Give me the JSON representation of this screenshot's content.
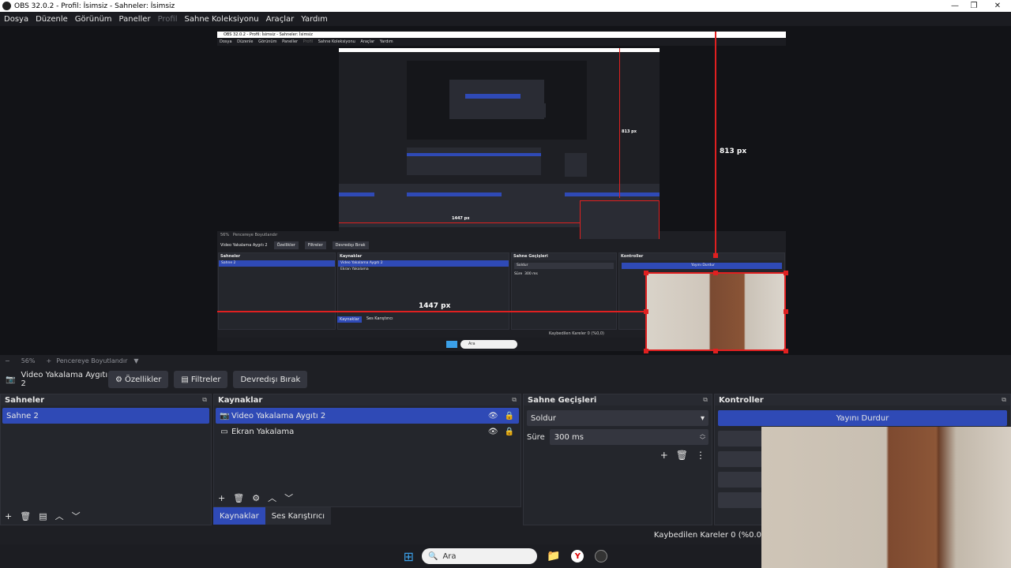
{
  "window": {
    "title": "OBS 32.0.2 - Profil: İsimsiz - Sahneler: İsimsiz",
    "minimize": "—",
    "maximize": "❐",
    "close": "✕"
  },
  "menu": [
    {
      "label": "Dosya",
      "enabled": true
    },
    {
      "label": "Düzenle",
      "enabled": true
    },
    {
      "label": "Görünüm",
      "enabled": true
    },
    {
      "label": "Paneller",
      "enabled": true
    },
    {
      "label": "Profil",
      "enabled": false
    },
    {
      "label": "Sahne Koleksiyonu",
      "enabled": true
    },
    {
      "label": "Araçlar",
      "enabled": true
    },
    {
      "label": "Yardım",
      "enabled": true
    }
  ],
  "preview": {
    "measure_horizontal": "1447 px",
    "measure_vertical": "813 px",
    "nested_title": "OBS 32.0.2 - Profil: İsimsiz - Sahneler: İsimsiz",
    "nested_menu": [
      "Dosya",
      "Düzenle",
      "Görünüm",
      "Paneller",
      "Profil",
      "Sahne Koleksiyonu",
      "Araçlar",
      "Yardım"
    ],
    "nested_zoom": "56%",
    "nested_fit": "Pencereye Boyutlandır",
    "nested_source": "Video Yakalama Aygıtı 2",
    "nested_props": "Özellikler",
    "nested_filters": "Filtreler",
    "nested_deactivate": "Devredışı Bırak",
    "nested_scenes": "Sahneler",
    "nested_scene_item": "Sahne 2",
    "nested_sources": "Kaynaklar",
    "nested_src1": "Video Yakalama Aygıtı 2",
    "nested_src2": "Ekran Yakalama",
    "nested_transitions": "Sahne Geçişleri",
    "nested_fade": "Soldur",
    "nested_duration_label": "Süre",
    "nested_duration": "300 ms",
    "nested_controls": "Kontroller",
    "nested_stop": "Yayını Durdur",
    "nested_tab1": "Kaynaklar",
    "nested_tab2": "Ses Karıştırıcı",
    "nested_status": "Kaybedilen Kareler 0 (%0,0)",
    "nested_search": "Ara",
    "nested_inner_measure": "1447 px",
    "nested_inner_vmeasure": "813 px"
  },
  "zoom": {
    "minus": "−",
    "value": "56%",
    "plus": "+",
    "fit": "Pencereye Boyutlandır",
    "caret": "▼"
  },
  "source_toolbar": {
    "source_name": "Video Yakalama Aygıtı 2",
    "properties": "Özellikler",
    "filters": "Filtreler",
    "deactivate": "Devredışı Bırak"
  },
  "scenes": {
    "title": "Sahneler",
    "items": [
      "Sahne 2"
    ]
  },
  "sources": {
    "title": "Kaynaklar",
    "items": [
      "Video Yakalama Aygıtı 2",
      "Ekran Yakalama"
    ]
  },
  "transitions": {
    "title": "Sahne Geçişleri",
    "selected": "Soldur",
    "duration_label": "Süre",
    "duration": "300 ms"
  },
  "controls": {
    "title": "Kontroller",
    "stop_stream": "Yayını Durdur"
  },
  "tabs": {
    "sources": "Kaynaklar",
    "mixer": "Ses Karıştırıcı"
  },
  "status": {
    "dropped_frames": "Kaybedilen Kareler 0 (%0.0"
  },
  "taskbar": {
    "search": "Ara"
  },
  "colors": {
    "accent": "#2f4ab6",
    "measure": "#e02020",
    "bg": "#1e1f24",
    "dock": "#24262c"
  }
}
